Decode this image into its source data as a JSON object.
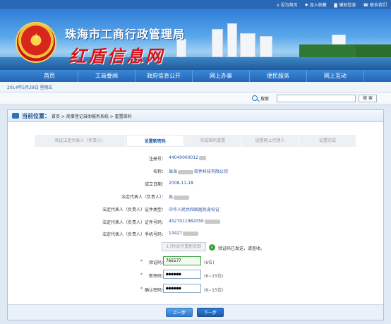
{
  "toplinks": [
    {
      "icon": "home-icon",
      "label": "设为首页"
    },
    {
      "icon": "plus-icon",
      "label": "加入收藏"
    },
    {
      "icon": "accessibility-icon",
      "label": "辅助信息"
    },
    {
      "icon": "contact-icon",
      "label": "联系我们"
    }
  ],
  "site": {
    "title": "珠海市工商行政管理局",
    "brand": "红盾信息网"
  },
  "nav": [
    "首页",
    "工商要闻",
    "政府信息公开",
    "网上办事",
    "便民服务",
    "网上互动"
  ],
  "date": "2014年5月29日 星期五",
  "search": {
    "label": "搜索",
    "button": "搜 索",
    "value": ""
  },
  "breadcrumb": {
    "title": "当前位置：",
    "path": "首页 > 商事登记自助服务系统 > 重置密码"
  },
  "steps": [
    {
      "label": "验证法定代表人（负责人）",
      "active": false
    },
    {
      "label": "设置新密码",
      "active": true
    },
    {
      "label": "完成密码重置",
      "active": false
    },
    {
      "label": "设置网上代理人",
      "active": false
    },
    {
      "label": "设置完成",
      "active": false
    }
  ],
  "info": {
    "reg_no": {
      "label": "注册号：",
      "value": "44040000012"
    },
    "name": {
      "label": "名称：",
      "value_prefix": "珠海",
      "value_suffix": "软件科技有限公司"
    },
    "found_date": {
      "label": "成立日期：",
      "value": "2008-11-18"
    },
    "rep": {
      "label": "法定代表人（负责人）：",
      "value": "吴"
    },
    "id_type": {
      "label": "法定代表人（负责人）证件类型：",
      "value": "中华人民共和国居民身份证"
    },
    "id_no": {
      "label": "法定代表人（负责人）证件号码：",
      "value": "4527011982050"
    },
    "phone": {
      "label": "法定代表人（负责人）手机号码：",
      "value": "13427"
    }
  },
  "sms": {
    "button": "17秒后可重新获取",
    "message": "验证码已发送，请查收。"
  },
  "form": {
    "code": {
      "label": "验证码：",
      "value": "765577",
      "hint": "(6位)"
    },
    "password": {
      "label": "新密码：",
      "value": "●●●●●●",
      "hint": "(6~15位)"
    },
    "confirm": {
      "label": "确认密码：",
      "value": "●●●●●●",
      "hint": "(6~15位)"
    }
  },
  "buttons": {
    "prev": "上一步",
    "next": "下一步"
  }
}
